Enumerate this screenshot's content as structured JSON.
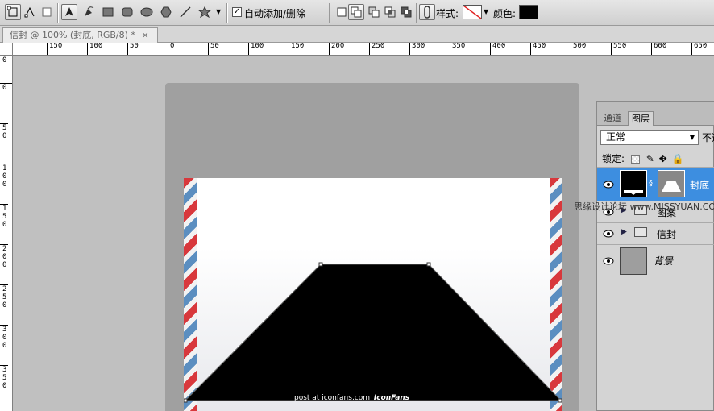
{
  "options_bar": {
    "auto_add_delete": {
      "label": "自动添加/删除",
      "checked": true
    },
    "style_label": "样式:",
    "color_label": "颜色:",
    "color_value": "#000000",
    "tools": [
      "shape-layers-icon",
      "paths-icon",
      "fill-pixels-icon",
      "pen-icon",
      "freeform-pen-icon",
      "rectangle-icon",
      "rounded-rectangle-icon",
      "ellipse-icon",
      "polygon-icon",
      "line-icon",
      "custom-shape-icon"
    ],
    "path_ops": [
      "new-path-icon",
      "add-to-shape-icon",
      "subtract-icon",
      "intersect-icon",
      "exclude-icon",
      "link-icon"
    ]
  },
  "document": {
    "tab_title": "信封 @ 100% (封底, RGB/8) *",
    "close_glyph": "×"
  },
  "rulers": {
    "horizontal": [
      "0",
      "150",
      "100",
      "50",
      "0",
      "50",
      "100",
      "150",
      "200",
      "250",
      "300",
      "350",
      "400",
      "450",
      "500",
      "550",
      "600",
      "650"
    ],
    "vertical": [
      "0",
      "0",
      "5 0",
      "1 0 0",
      "1 5 0",
      "2 0 0",
      "2 5 0",
      "3 0 0",
      "3 5 0"
    ]
  },
  "canvas": {
    "credit_text": "post at iconfans.com",
    "credit_logo": "IconFans"
  },
  "layers_panel": {
    "tabs": [
      {
        "label": "通道",
        "active": false
      },
      {
        "label": "图层",
        "active": true
      }
    ],
    "blend_mode": "正常",
    "opacity_label": "不透",
    "lock_label": "锁定:",
    "layers": [
      {
        "name": "封底",
        "type": "shape",
        "selected": true,
        "visible": true
      },
      {
        "name": "图案",
        "type": "group",
        "selected": false,
        "visible": true
      },
      {
        "name": "信封",
        "type": "group",
        "selected": false,
        "visible": true
      },
      {
        "name": "背景",
        "type": "background",
        "selected": false,
        "visible": true
      }
    ]
  },
  "watermark": "思缘设计论坛 www.MISSYUAN.COM",
  "colors": {
    "selection": "#3d8ee0",
    "guide": "#5fd7e8",
    "stripe_red": "#d8383c",
    "stripe_blue": "#5b8ec0"
  }
}
